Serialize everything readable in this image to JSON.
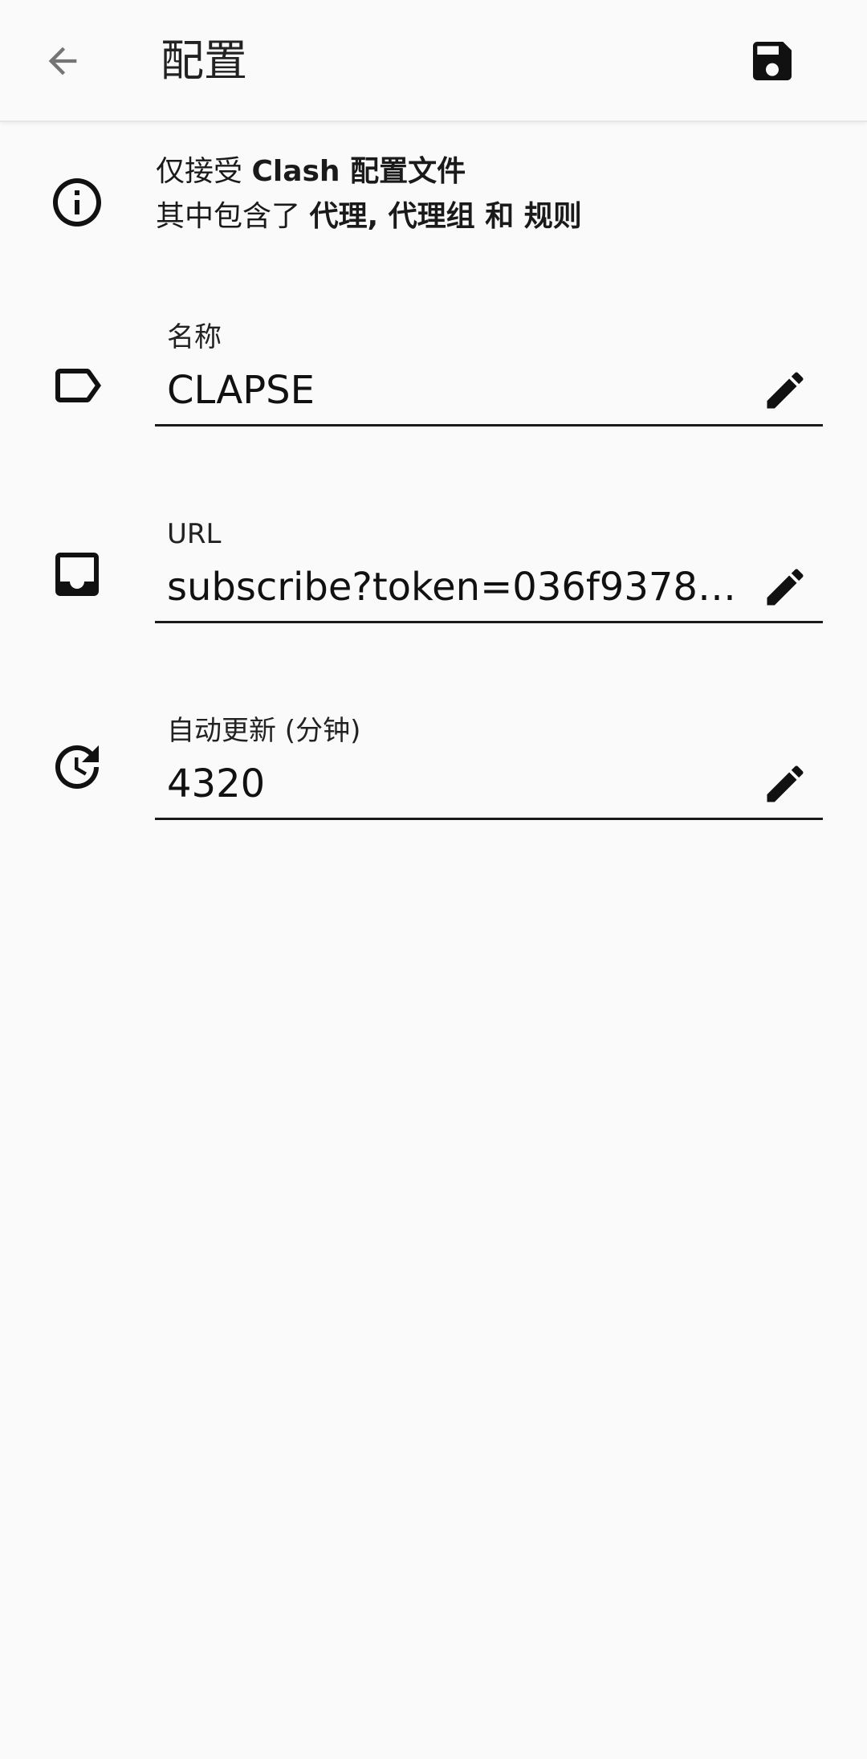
{
  "appbar": {
    "title": "配置",
    "back_icon": "arrow-back-icon",
    "save_icon": "save-icon"
  },
  "info": {
    "line1_prefix": "仅接受 ",
    "line1_bold": "Clash 配置文件",
    "line2_prefix": "其中包含了 ",
    "line2_bold_1": "代理, 代理组",
    "line2_mid": " 和 ",
    "line2_bold_2": "规则"
  },
  "fields": {
    "name": {
      "label": "名称",
      "value": "CLAPSE",
      "icon": "label-icon"
    },
    "url": {
      "label": "URL",
      "value": "subscribe?token=036f9378635…",
      "icon": "inbox-icon"
    },
    "interval": {
      "label": "自动更新 (分钟)",
      "value": "4320",
      "icon": "update-clock-icon"
    }
  },
  "colors": {
    "background": "#fafafa",
    "text": "#1a1a1a",
    "icon": "#111111",
    "back_icon": "#757575"
  }
}
